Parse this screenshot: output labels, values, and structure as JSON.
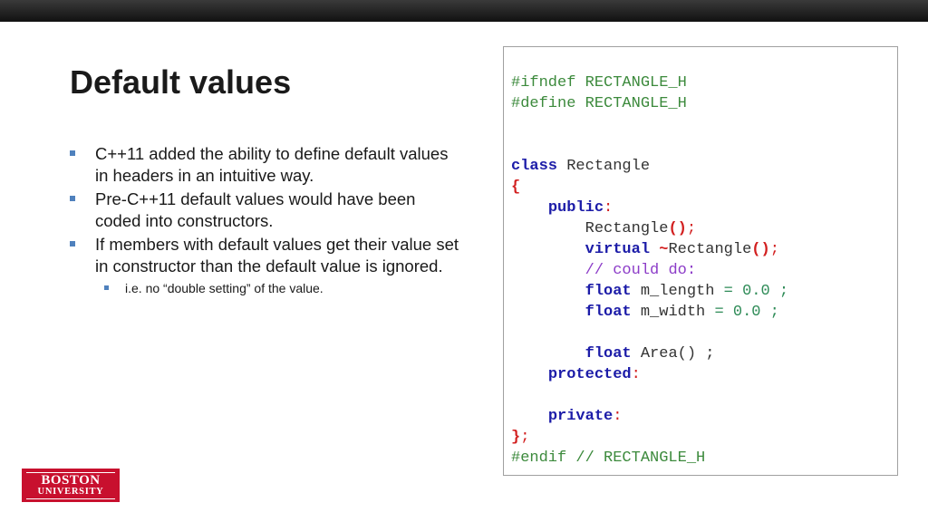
{
  "slide": {
    "title": "Default values",
    "bullets": [
      "C++11 added the ability to define default values in headers in an intuitive way.",
      "Pre-C++11 default values would have been coded into constructors.",
      "If members with default values get their value set in constructor than the default value is ignored."
    ],
    "sub_bullets": [
      "i.e. no “double setting” of the value."
    ]
  },
  "code": {
    "line1": "#ifndef RECTANGLE_H",
    "line2": "#define RECTANGLE_H",
    "kw_class": "class",
    "class_name": " Rectangle",
    "open_brace": "{",
    "kw_public": "public",
    "colon": ":",
    "ctor_name": "Rectangle",
    "parens": "()",
    "semicolon": ";",
    "kw_virtual": "virtual",
    "tilde": "~",
    "dtor_name": "Rectangle",
    "comment_could_do": "// could do:",
    "kw_float": "float",
    "m_length": " m_length",
    "m_length_init": " = 0.0 ;",
    "m_width": " m_width",
    "m_width_init": " = 0.0 ;",
    "area_decl": " Area() ;",
    "kw_protected": "protected",
    "kw_private": "private",
    "close_brace": "}",
    "endif": "#endif // RECTANGLE_H"
  },
  "logo": {
    "line1": "BOSTON",
    "line2": "UNIVERSITY"
  },
  "colors": {
    "keyword": "#1c1ca8",
    "preprocessor": "#3c8a3c",
    "punctuation": "#d21f1f",
    "comment": "#8c3cc8",
    "bullet_marker": "#4f81bd",
    "logo_bg": "#c8102e",
    "highlight": "#fafbd6"
  }
}
